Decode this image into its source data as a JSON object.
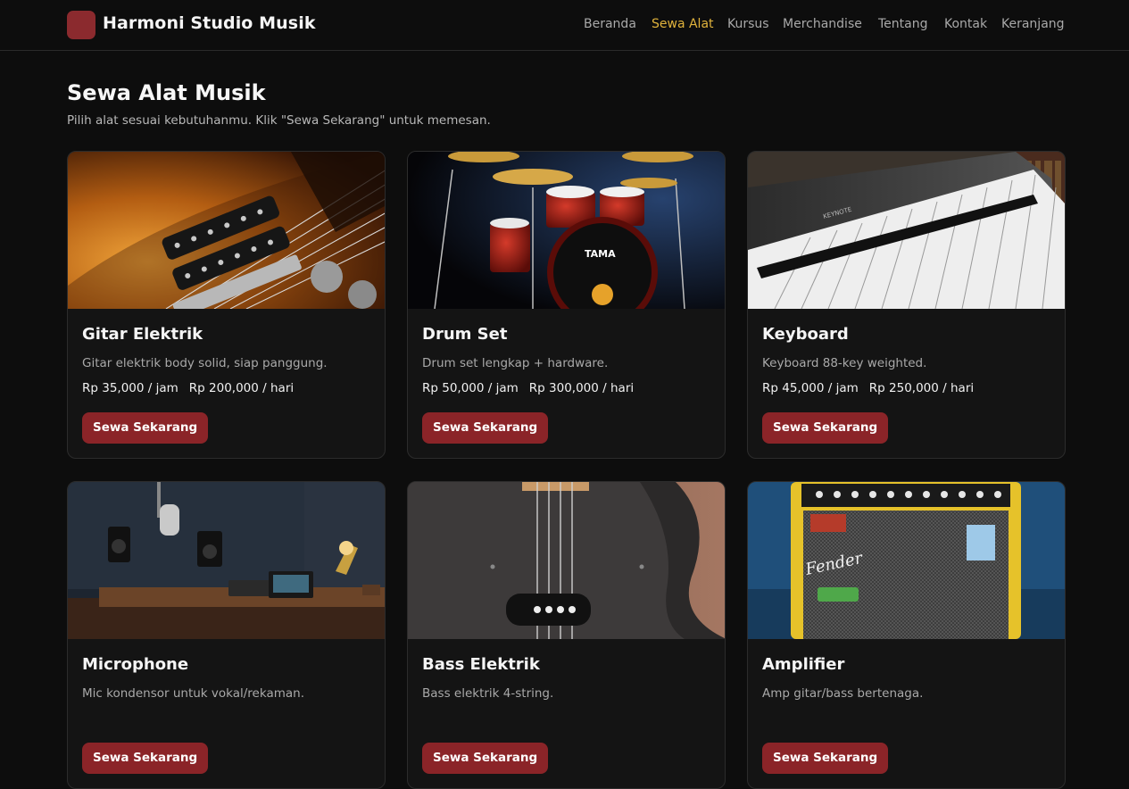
{
  "brand": {
    "name": "Harmoni Studio Musik",
    "color": "#8b2a2e"
  },
  "nav": {
    "items": [
      "Beranda",
      "Sewa Alat",
      "Kursus",
      "Merchandise",
      "Tentang",
      "Kontak",
      "Keranjang"
    ],
    "active": "Sewa Alat",
    "active_color": "#e0b33c"
  },
  "page": {
    "title": "Sewa Alat Musik",
    "subtitle": "Pilih alat sesuai kebutuhanmu. Klik \"Sewa Sekarang\" untuk memesan."
  },
  "products": [
    {
      "name": "Gitar Elektrik",
      "desc": "Gitar elektrik body solid, siap panggung.",
      "price_hour": "Rp 35,000 / jam",
      "price_day": "Rp 200,000 / hari",
      "button": "Sewa Sekarang",
      "image_icon": "electric-guitar-photo"
    },
    {
      "name": "Drum Set",
      "desc": "Drum set lengkap + hardware.",
      "price_hour": "Rp 50,000 / jam",
      "price_day": "Rp 300,000 / hari",
      "button": "Sewa Sekarang",
      "image_icon": "drum-set-photo"
    },
    {
      "name": "Keyboard",
      "desc": "Keyboard 88-key weighted.",
      "price_hour": "Rp 45,000 / jam",
      "price_day": "Rp 250,000 / hari",
      "button": "Sewa Sekarang",
      "image_icon": "keyboard-photo"
    },
    {
      "name": "Microphone",
      "desc": "Mic kondensor untuk vokal/rekaman.",
      "price_hour": "",
      "price_day": "",
      "button": "Sewa Sekarang",
      "image_icon": "studio-microphone-photo"
    },
    {
      "name": "Bass Elektrik",
      "desc": "Bass elektrik 4-string.",
      "price_hour": "",
      "price_day": "",
      "button": "Sewa Sekarang",
      "image_icon": "bass-guitar-photo"
    },
    {
      "name": "Amplifier",
      "desc": "Amp gitar/bass bertenaga.",
      "price_hour": "",
      "price_day": "",
      "button": "Sewa Sekarang",
      "image_icon": "amplifier-photo"
    }
  ],
  "image_labels": {
    "drum_brand": "TAMA",
    "keyboard_brand": "KEYNOTE",
    "amp_brand": "Fender"
  },
  "colors": {
    "button": "#8b2428",
    "background": "#0d0d0d",
    "card": "#141414"
  }
}
